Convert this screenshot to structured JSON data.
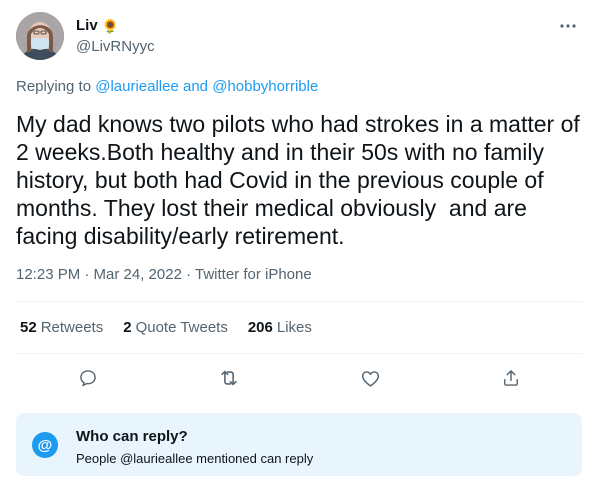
{
  "author": {
    "name": "Liv",
    "emoji": "🌻",
    "handle": "@LivRNyyc"
  },
  "reply_to": {
    "prefix": "Replying to",
    "user1": "@laurieallee",
    "conj": "and",
    "user2": "@hobbyhorrible"
  },
  "tweet": {
    "text": "My dad knows two pilots who had strokes in a matter of 2 weeks.Both healthy and in their 50s with no family history, but both had Covid in the previous couple of months. They lost their medical obviously  and are facing disability/early retirement.",
    "time": "12:23 PM · Mar 24, 2022 · Twitter for iPhone"
  },
  "stats": {
    "retweets_count": "52",
    "retweets_label": "Retweets",
    "quotes_count": "2",
    "quotes_label": "Quote Tweets",
    "likes_count": "206",
    "likes_label": "Likes"
  },
  "actions": [
    "reply-icon",
    "retweet-icon",
    "like-icon",
    "share-icon"
  ],
  "who_can_reply": {
    "icon": "@",
    "title": "Who can reply?",
    "subtitle": "People @laurieallee mentioned can reply"
  },
  "colors": {
    "accent": "#1d9bf0",
    "secondary_text": "#536471",
    "info_box_bg": "#e8f5fd"
  }
}
